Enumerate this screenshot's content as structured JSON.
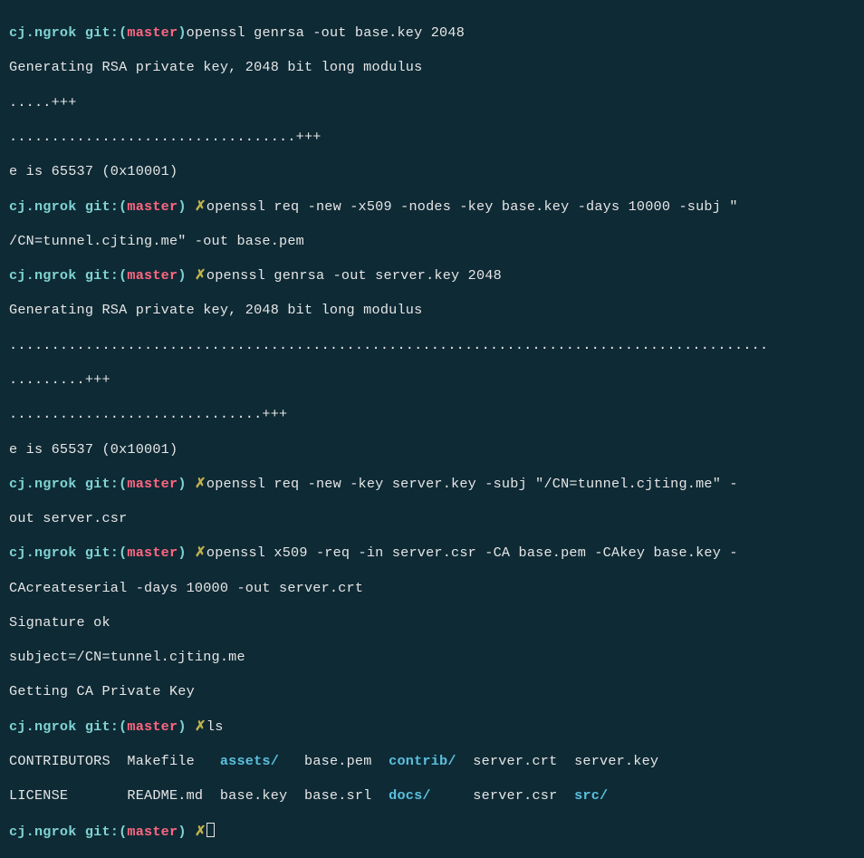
{
  "prompt": {
    "cwd": "cj.ngrok",
    "git_label": "git:(",
    "branch": "master",
    "git_close": ")",
    "dirty": "✗"
  },
  "cmd1": "openssl genrsa -out base.key 2048",
  "out1a": "Generating RSA private key, 2048 bit long modulus",
  "out1b": ".....+++",
  "out1c": "..................................+++",
  "out1d": "e is 65537 (0x10001)",
  "cmd2a": "openssl req -new -x509 -nodes -key base.key -days 10000 -subj \"",
  "cmd2b": "/CN=tunnel.cjting.me\" -out base.pem",
  "cmd3": "openssl genrsa -out server.key 2048",
  "out3a": "Generating RSA private key, 2048 bit long modulus",
  "out3b": "..........................................................................................",
  "out3c": ".........+++",
  "out3d": "..............................+++",
  "out3e": "e is 65537 (0x10001)",
  "cmd4a": "openssl req -new -key server.key -subj \"/CN=tunnel.cjting.me\" -",
  "cmd4b": "out server.csr",
  "cmd5a": "openssl x509 -req -in server.csr -CA base.pem -CAkey base.key -",
  "cmd5b": "CAcreateserial -days 10000 -out server.crt",
  "out5a": "Signature ok",
  "out5b": "subject=/CN=tunnel.cjting.me",
  "out5c": "Getting CA Private Key",
  "cmd6": "ls",
  "ls": {
    "r1a": "CONTRIBUTORS  Makefile   ",
    "r1b": "assets/",
    "r1c": "   base.pem  ",
    "r1d": "contrib/",
    "r1e": "  server.crt  server.key",
    "r2a": "LICENSE       README.md  base.key  base.srl  ",
    "r2b": "docs/",
    "r2c": "     server.csr  ",
    "r2d": "src/"
  }
}
